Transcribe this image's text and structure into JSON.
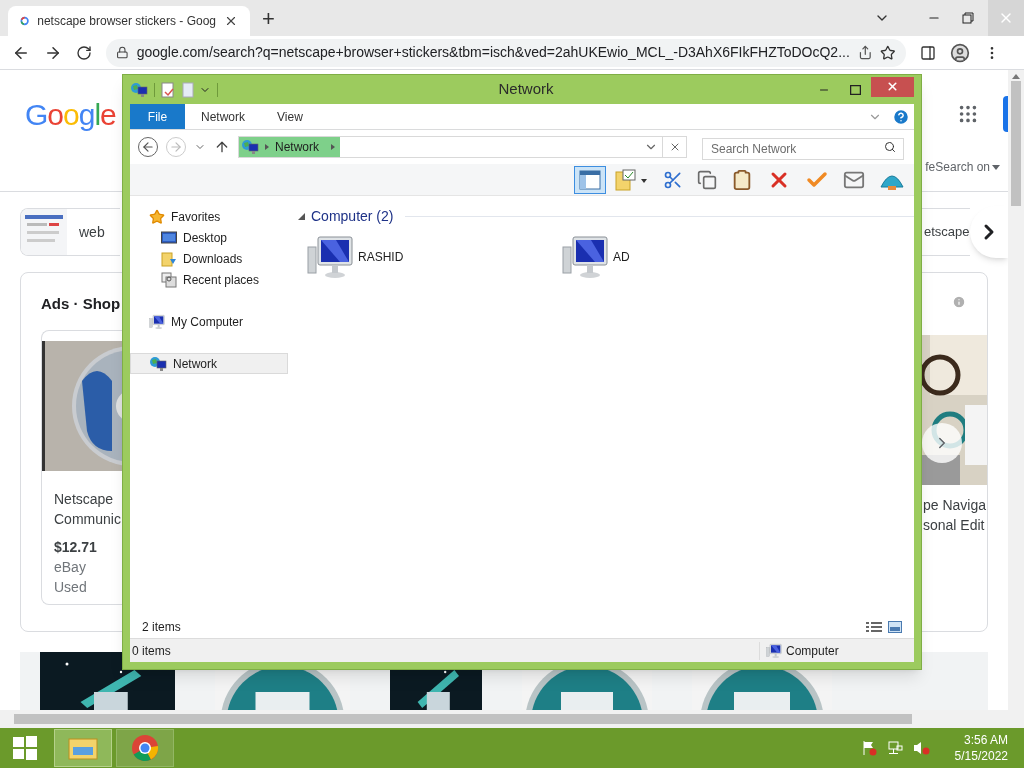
{
  "browser": {
    "tabs": [
      {
        "title": "netscape browser stickers - Goog",
        "selected": true
      }
    ],
    "new_tab": "+",
    "url": "google.com/search?q=netscape+browser+stickers&tbm=isch&ved=2ahUKEwio_MCL_-D3AhX6FIkFHZToDOcQ2..."
  },
  "page": {
    "logo": "Google",
    "safesearch": "feSearch on",
    "chips": [
      {
        "label": "web"
      },
      {
        "label": "etscape"
      }
    ],
    "ads_heading": "Ads · **Shop**",
    "products": [
      {
        "title_lines": [
          "Netscape",
          "Communic"
        ],
        "price": "$12.71",
        "seller": "eBay",
        "condition": "Used"
      },
      {
        "title_lines": [
          "pe Naviga",
          "sonal Edit"
        ]
      }
    ]
  },
  "explorer": {
    "title": "Network",
    "ribbon_tabs": [
      {
        "label": "File",
        "kind": "file"
      },
      {
        "label": "Network",
        "kind": "tab"
      },
      {
        "label": "View",
        "kind": "tab"
      }
    ],
    "breadcrumb": "Network",
    "search_placeholder": "Search Network",
    "toolbar": [
      {
        "kind": "preview-pane",
        "selected": true
      },
      {
        "kind": "properties",
        "selected": false
      },
      {
        "kind": "cut",
        "selected": false
      },
      {
        "kind": "copy",
        "selected": false
      },
      {
        "kind": "paste",
        "selected": false
      },
      {
        "kind": "delete",
        "selected": false
      },
      {
        "kind": "check",
        "selected": false
      },
      {
        "kind": "rename",
        "selected": false
      },
      {
        "kind": "shell",
        "selected": false
      }
    ],
    "nav": [
      {
        "label": "Favorites",
        "kind": "star",
        "selected": false,
        "children": [
          {
            "label": "Desktop",
            "kind": "desktop",
            "selected": false
          },
          {
            "label": "Downloads",
            "kind": "downloads",
            "selected": false
          },
          {
            "label": "Recent places",
            "kind": "recent",
            "selected": false
          }
        ]
      },
      {
        "label": "My Computer",
        "kind": "computer",
        "selected": false
      },
      {
        "label": "Network",
        "kind": "network",
        "selected": true
      }
    ],
    "group": {
      "header": "Computer (2)",
      "expanded": true
    },
    "items": [
      {
        "name": "RASHID"
      },
      {
        "name": "AD"
      }
    ],
    "item_count": "2 items",
    "status_selection": "0 items",
    "status_zone": "Computer"
  },
  "taskbar": {
    "apps": [
      {
        "kind": "explorer",
        "selected": true
      },
      {
        "kind": "chrome",
        "selected": false
      }
    ],
    "time": "3:56 AM",
    "date": "5/15/2022"
  }
}
